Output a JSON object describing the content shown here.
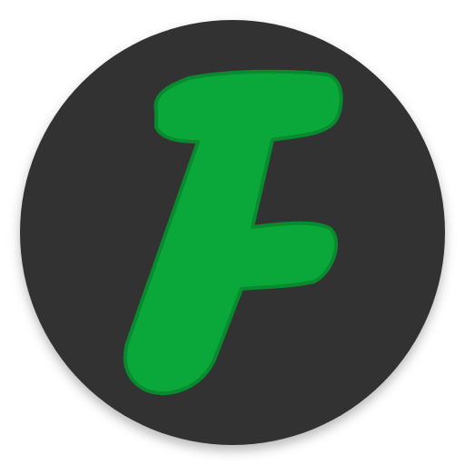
{
  "icon": {
    "name": "f-letter-app-icon",
    "glyph": "F",
    "background_color": "#333333",
    "letter_color": "#0aa83a",
    "letter_outline_color": "#088a2f"
  }
}
